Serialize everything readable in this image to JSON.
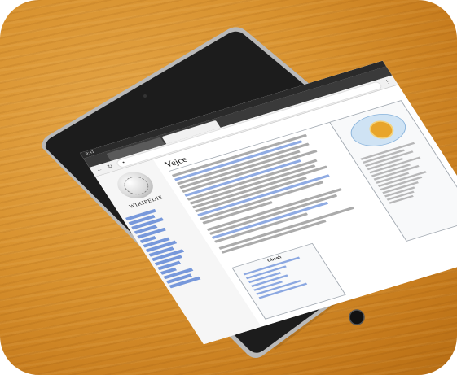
{
  "scene": {
    "description_none": "",
    "table_color": "#d8922f",
    "tablet_color": "#1c1c1c",
    "frame_color": "#3a3a3a"
  },
  "screen": {
    "status_time": "9:41",
    "browser_tabs": [
      "",
      ""
    ],
    "page_title": "Vejce",
    "wordmark": "WIKIPEDIE",
    "toc_title": "Obsah",
    "icons": [
      "back-icon",
      "reload-icon",
      "lock-icon",
      "home-button-icon"
    ]
  }
}
